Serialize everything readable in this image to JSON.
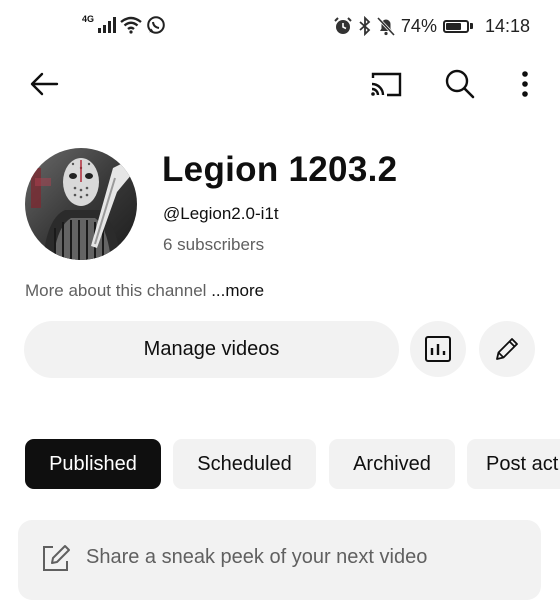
{
  "status_bar": {
    "network_label": "4G",
    "battery_percent": "74%",
    "battery_level": 0.74,
    "time": "14:18"
  },
  "top_bar": {
    "icons": [
      "back-arrow-icon",
      "cast-icon",
      "search-icon",
      "more-vert-icon"
    ]
  },
  "channel": {
    "title": "Legion 1203.2",
    "handle": "@Legion2.0-i1t",
    "subscribers": "6 subscribers",
    "about_text": "More about this channel",
    "more_link": "...more"
  },
  "actions": {
    "manage_videos_label": "Manage videos",
    "analytics_icon": "bar-chart-icon",
    "edit_icon": "pencil-icon"
  },
  "filter_chips": [
    {
      "label": "Published",
      "selected": true
    },
    {
      "label": "Scheduled",
      "selected": false
    },
    {
      "label": "Archived",
      "selected": false
    },
    {
      "label": "Post act",
      "selected": false
    }
  ],
  "composer": {
    "placeholder": "Share a sneak peek of your next video"
  },
  "colors": {
    "background": "#ffffff",
    "chip_bg": "#f2f2f2",
    "chip_active_bg": "#0f0f0f",
    "secondary_text": "#606060"
  }
}
